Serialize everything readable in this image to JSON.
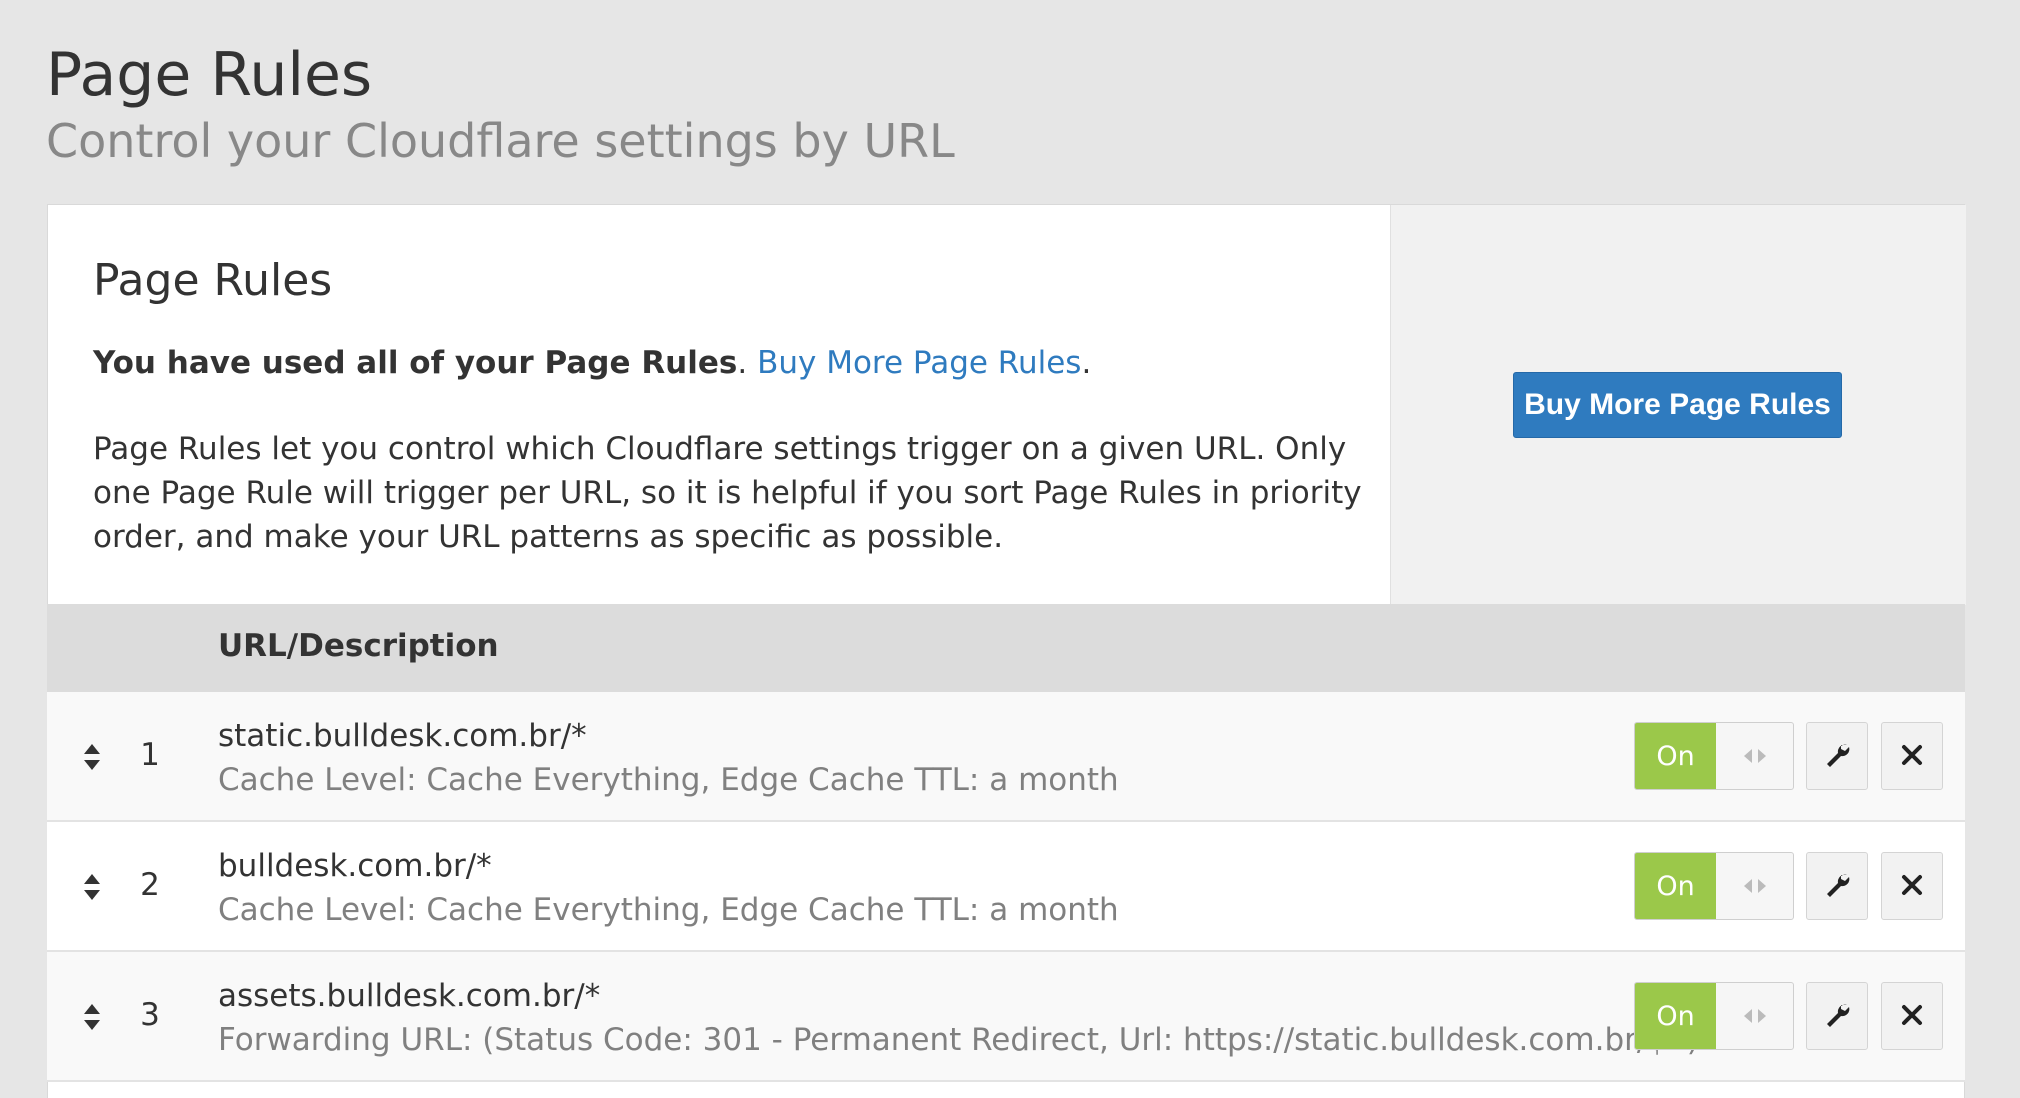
{
  "header": {
    "title": "Page Rules",
    "subtitle": "Control your Cloudflare settings by URL"
  },
  "card": {
    "heading": "Page Rules",
    "usage_bold": "You have used all of your Page Rules",
    "usage_sep": ". ",
    "usage_link": "Buy More Page Rules",
    "usage_end": ".",
    "description": "Page Rules let you control which Cloudflare settings trigger on a given URL. Only one Page Rule will trigger per URL, so it is helpful if you sort Page Rules in priority order, and make your URL patterns as specific as possible.",
    "buy_button_label": "Buy More Page Rules"
  },
  "table": {
    "column_url": "URL/Description",
    "rows": [
      {
        "number": "1",
        "url": "static.bulldesk.com.br/*",
        "settings": "Cache Level: Cache Everything, Edge Cache TTL: a month",
        "status_label": "On"
      },
      {
        "number": "2",
        "url": "bulldesk.com.br/*",
        "settings": "Cache Level: Cache Everything, Edge Cache TTL: a month",
        "status_label": "On"
      },
      {
        "number": "3",
        "url": "assets.bulldesk.com.br/*",
        "settings": "Forwarding URL: (Status Code: 301 - Permanent Redirect, Url: https://static.bulldesk.com.br/$1)",
        "status_label": "On"
      }
    ]
  },
  "colors": {
    "accent_blue": "#2f7bbf",
    "toggle_on_green": "#9bc84a",
    "background": "#e6e6e6"
  },
  "icons": {
    "drag": "sort-arrows-icon",
    "toggle_knob": "double-chevron-icon",
    "edit": "wrench-icon",
    "delete": "close-icon"
  }
}
